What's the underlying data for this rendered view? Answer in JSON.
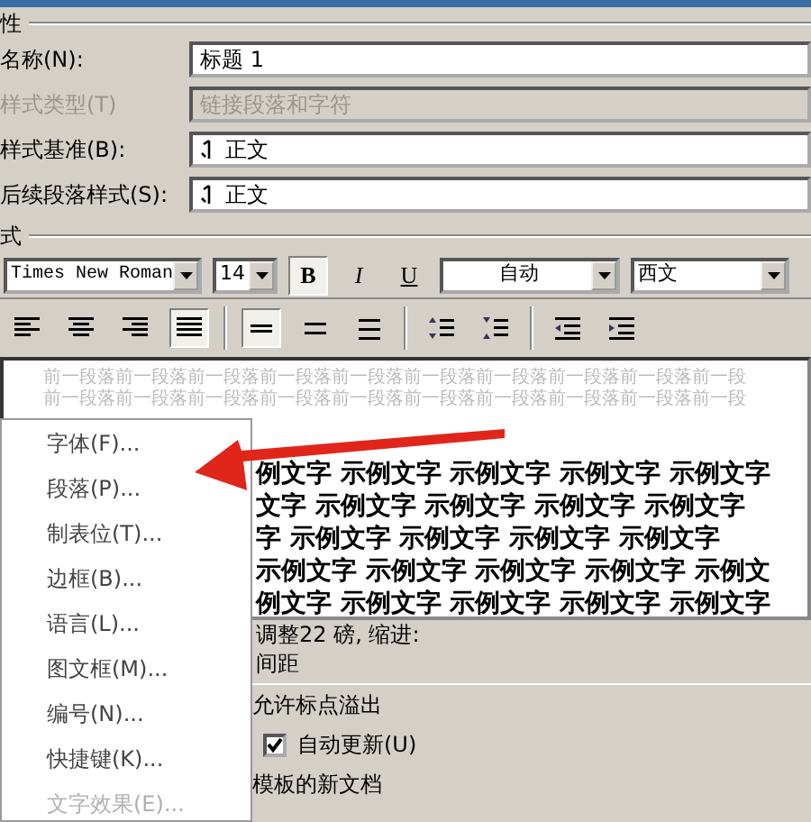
{
  "section_properties": {
    "label": "性"
  },
  "fields": [
    {
      "label": "名称(N):",
      "value": "标题 1",
      "kind": "text",
      "disabled": false
    },
    {
      "label": "样式类型(T)",
      "value": "链接段落和字符",
      "kind": "select",
      "disabled": true
    },
    {
      "label": "样式基准(B):",
      "value": "正文",
      "kind": "style-select",
      "disabled": false
    },
    {
      "label": "后续段落样式(S):",
      "value": "正文",
      "kind": "style-select",
      "disabled": false
    }
  ],
  "section_format": {
    "label": "式"
  },
  "font_toolbar": {
    "font": "Times New Roman",
    "size": "14",
    "font_color": "自动",
    "script": "西文",
    "style_buttons": [
      {
        "label": "B",
        "kind": "bold",
        "selected": true
      },
      {
        "label": "I",
        "kind": "italic",
        "selected": false
      },
      {
        "label": "U",
        "kind": "underline",
        "selected": false
      }
    ]
  },
  "paragraph_toolbar": [
    [
      {
        "kind": "align-left",
        "selected": false
      },
      {
        "kind": "align-center",
        "selected": false
      },
      {
        "kind": "align-right",
        "selected": false
      },
      {
        "kind": "justify",
        "selected": true
      }
    ],
    [
      {
        "kind": "single-spacing",
        "selected": true
      },
      {
        "kind": "one-half-spacing",
        "selected": false
      },
      {
        "kind": "double-spacing",
        "selected": false
      }
    ],
    [
      {
        "kind": "space-increase",
        "selected": false
      },
      {
        "kind": "space-decrease",
        "selected": false
      }
    ],
    [
      {
        "kind": "indent-decrease",
        "selected": false
      },
      {
        "kind": "indent-increase",
        "selected": false
      }
    ]
  ],
  "preview": {
    "previous_lines": [
      "前一段落前一段落前一段落前一段落前一段落前一段落前一段落前一段落前一段落前一段",
      "前一段落前一段落前一段落前一段落前一段落前一段落前一段落前一段落前一段落前一段"
    ],
    "sample_lines": [
      "例文字 示例文字 示例文字 示例文字 示例文字",
      "文字 示例文字 示例文字 示例文字 示例文字",
      "字 示例文字 示例文字 示例文字 示例文字",
      "示例文字 示例文字 示例文字 示例文字 示例文",
      "例文字 示例文字 示例文字 示例文字 示例文字"
    ]
  },
  "description": [
    "调整22 磅, 缩进:",
    "间距"
  ],
  "option_text": "允许标点溢出",
  "auto_update": {
    "label": "自动更新(U)",
    "checked": true
  },
  "template_text": "模板的新文档",
  "context_menu": [
    {
      "label": "字体(F)...",
      "disabled": false
    },
    {
      "label": "段落(P)...",
      "disabled": false
    },
    {
      "label": "制表位(T)...",
      "disabled": false
    },
    {
      "label": "边框(B)...",
      "disabled": false
    },
    {
      "label": "语言(L)...",
      "disabled": false
    },
    {
      "label": "图文框(M)...",
      "disabled": false
    },
    {
      "label": "编号(N)...",
      "disabled": false
    },
    {
      "label": "快捷键(K)...",
      "disabled": false
    },
    {
      "label": "文字效果(E)...",
      "disabled": true
    }
  ]
}
